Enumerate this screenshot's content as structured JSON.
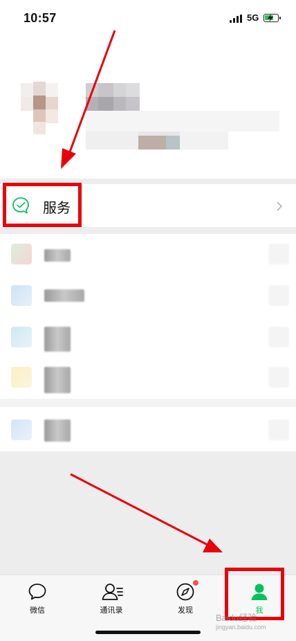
{
  "status_bar": {
    "time": "10:57",
    "network": "5G"
  },
  "service": {
    "label": "服务"
  },
  "tabs": [
    {
      "label": "微信",
      "icon": "chat-bubble-icon"
    },
    {
      "label": "通讯录",
      "icon": "contacts-icon"
    },
    {
      "label": "发现",
      "icon": "compass-icon"
    },
    {
      "label": "我",
      "icon": "person-icon"
    }
  ],
  "watermark": {
    "text": "Baidu经验",
    "sub": "jingyan.baidu.com"
  },
  "colors": {
    "brand_green": "#07c160",
    "annotation_red": "#e8000b",
    "badge_red": "#fa5151",
    "page_gray": "#ededed"
  }
}
